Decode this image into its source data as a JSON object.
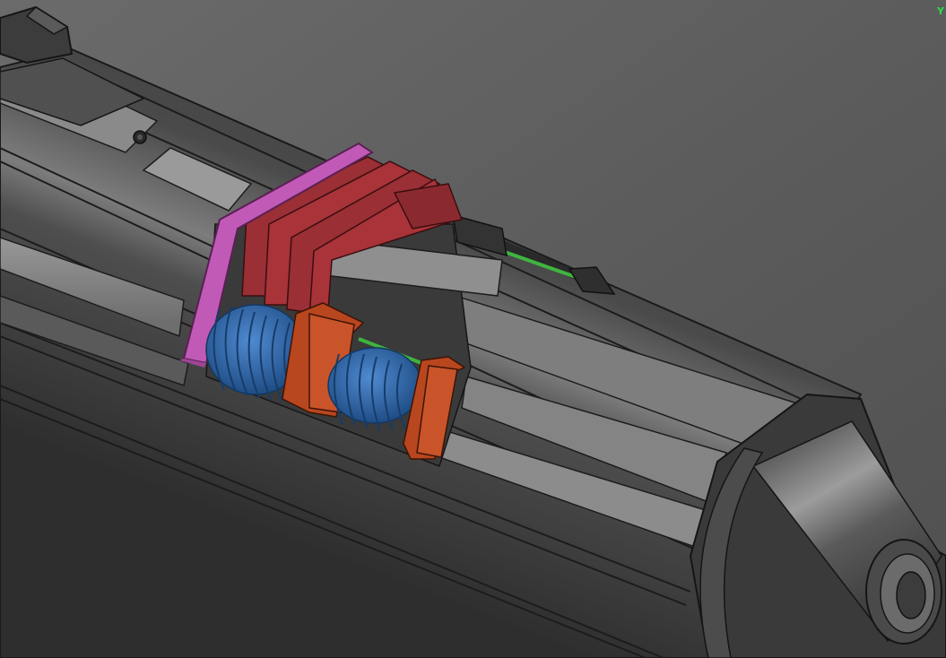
{
  "viewport": {
    "axis_label": "Y"
  },
  "model": {
    "components": [
      "main-tube",
      "cone-emitter",
      "end-plate",
      "bracket-stack",
      "spring-large",
      "spring-small",
      "slider-block",
      "end-block",
      "guide-rod",
      "rear-collar"
    ],
    "colors": {
      "background": "#5d5d5d",
      "body": "#454545",
      "body_light": "#8e8e8e",
      "end_plate": "#c15ab7",
      "bracket": "#9a2f35",
      "slider": "#b8461f",
      "spring": "#2e66a8",
      "rod": "#3fb43f",
      "edge": "#1a1a1a"
    }
  }
}
